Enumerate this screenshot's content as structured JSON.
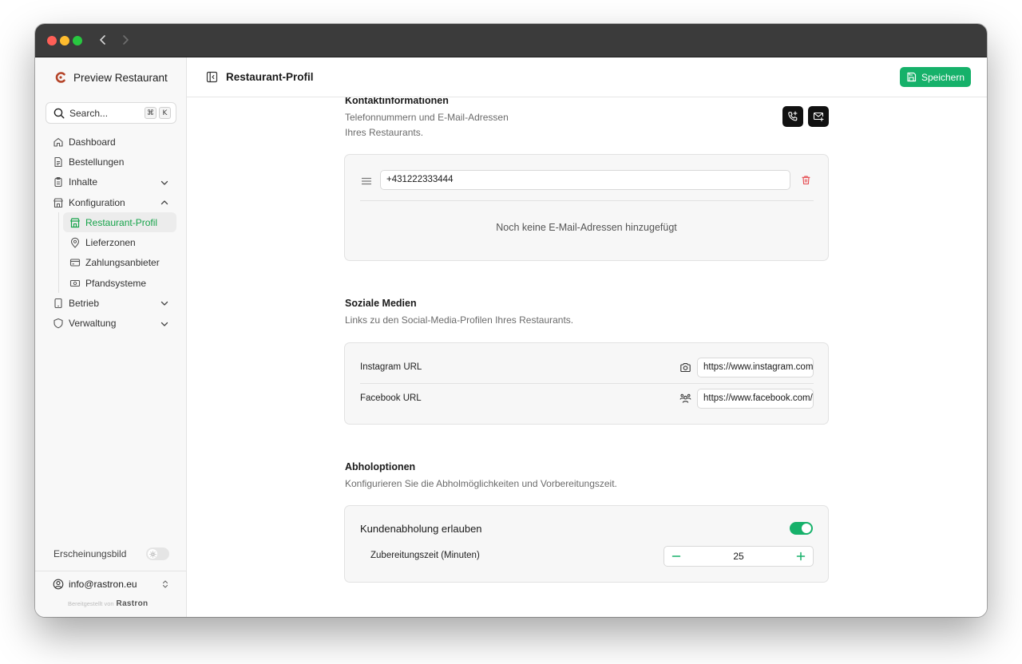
{
  "theme": {
    "accent": "#16b16a",
    "active_nav_text": "#16a34a",
    "danger": "#e5484d",
    "titlebar": "#3b3b3b"
  },
  "sidebar": {
    "brand": "Preview Restaurant",
    "search": {
      "label": "Search...",
      "shortcut": [
        "⌘",
        "K"
      ]
    },
    "items": [
      {
        "label": "Dashboard",
        "icon": "home-icon"
      },
      {
        "label": "Bestellungen",
        "icon": "document-icon"
      },
      {
        "label": "Inhalte",
        "icon": "clipboard-icon",
        "expanded": false
      },
      {
        "label": "Konfiguration",
        "icon": "store-icon",
        "expanded": true,
        "children": [
          {
            "label": "Restaurant-Profil",
            "icon": "store-icon",
            "active": true
          },
          {
            "label": "Lieferzonen",
            "icon": "map-pin-icon"
          },
          {
            "label": "Zahlungsanbieter",
            "icon": "credit-card-icon"
          },
          {
            "label": "Pfandsysteme",
            "icon": "banknote-icon"
          }
        ]
      },
      {
        "label": "Betrieb",
        "icon": "tablet-icon",
        "expanded": false
      },
      {
        "label": "Verwaltung",
        "icon": "shield-icon",
        "expanded": false
      }
    ],
    "appearance_label": "Erscheinungsbild",
    "account_email": "info@rastron.eu",
    "built_by": "Bereitgestellt von",
    "built_brand": "Rastron"
  },
  "header": {
    "title": "Restaurant-Profil",
    "save_label": "Speichern"
  },
  "contact": {
    "title": "Kontaktinformationen",
    "description": "Telefonnummern und E-Mail-Adressen Ihres Restaurants.",
    "phone": "+431222333444",
    "empty_email": "Noch keine E-Mail-Adressen hinzugefügt"
  },
  "social": {
    "title": "Soziale Medien",
    "description": "Links zu den Social-Media-Profilen Ihres Restaurants.",
    "instagram_label": "Instagram URL",
    "instagram_value": "https://www.instagram.com/",
    "facebook_label": "Facebook URL",
    "facebook_value": "https://www.facebook.com/"
  },
  "pickup": {
    "title": "Abholoptionen",
    "description": "Konfigurieren Sie die Abholmöglichkeiten und Vorbereitungszeit.",
    "allow_label": "Kundenabholung erlauben",
    "allow_enabled": true,
    "prep_label": "Zubereitungszeit (Minuten)",
    "prep_value": "25"
  }
}
